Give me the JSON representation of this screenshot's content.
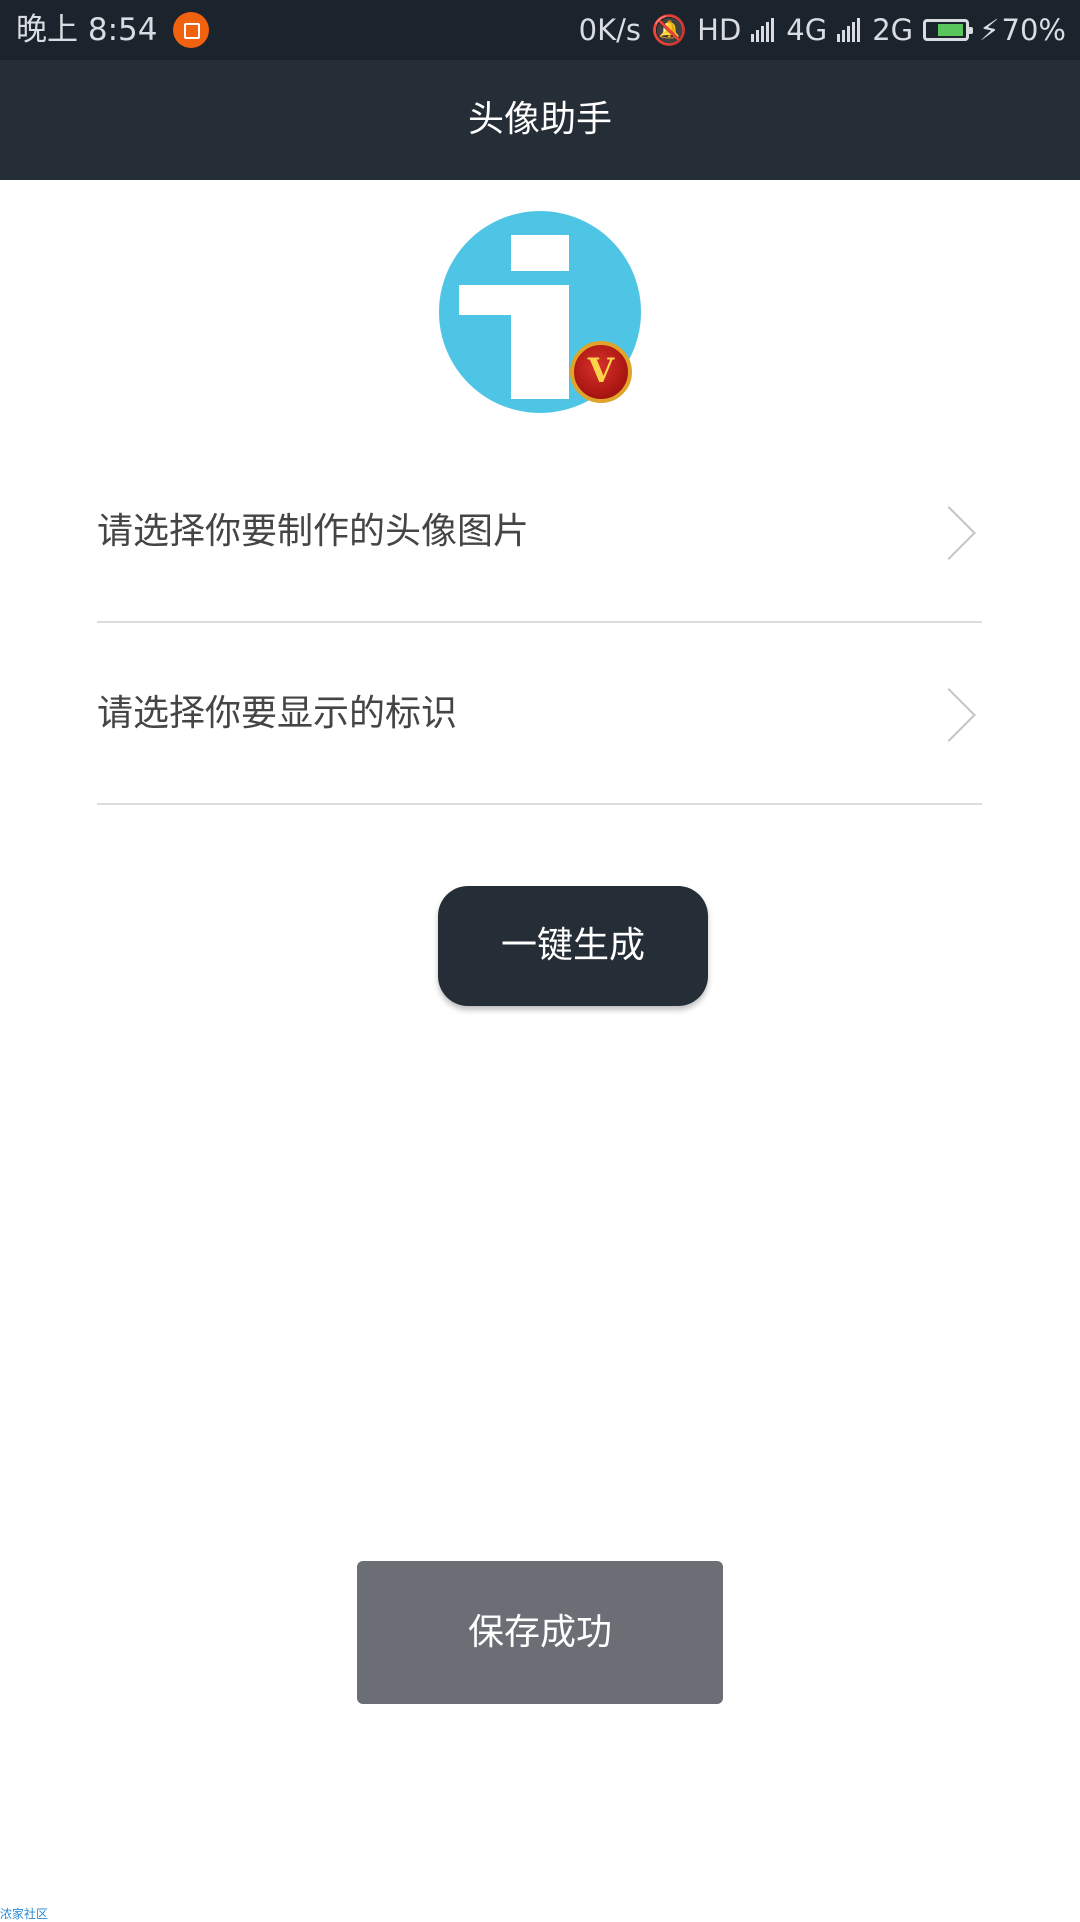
{
  "status_bar": {
    "time": "晚上 8:54",
    "network_speed": "0K/s",
    "hd": "HD",
    "net1": "4G",
    "net2": "2G",
    "battery": "70%",
    "battery_level": 0.7,
    "icons": [
      "notification-app-icon",
      "bell-muted-icon",
      "signal-icon",
      "charging-icon"
    ]
  },
  "header": {
    "title": "头像助手"
  },
  "avatar": {
    "badge_letter": "V"
  },
  "options": [
    {
      "label": "请选择你要制作的头像图片"
    },
    {
      "label": "请选择你要显示的标识"
    }
  ],
  "actions": {
    "generate_label": "一键生成"
  },
  "toast": {
    "message": "保存成功"
  },
  "watermark": {
    "text": "浓家社区"
  },
  "colors": {
    "bar": "#252d36",
    "avatar_bg": "#4fc5e6",
    "toast_bg": "#6b6e75"
  }
}
